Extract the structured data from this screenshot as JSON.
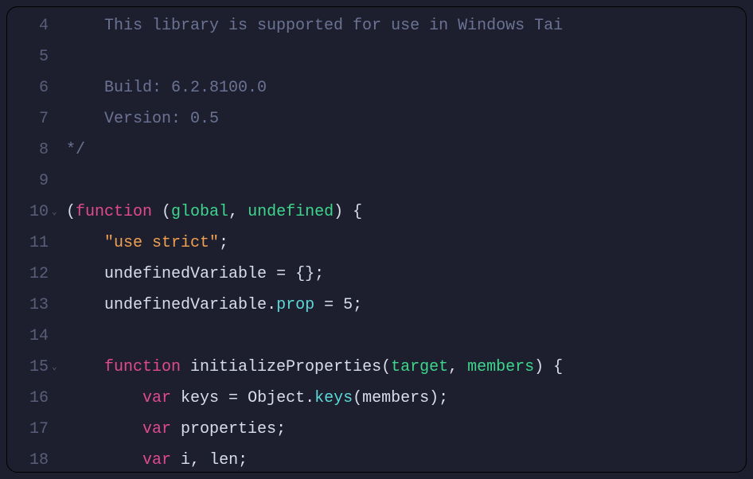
{
  "lines": [
    {
      "num": "4",
      "fold": "",
      "tokens": [
        {
          "cls": "comment",
          "text": "    This library is supported for use in Windows Tai"
        }
      ]
    },
    {
      "num": "5",
      "fold": "",
      "tokens": []
    },
    {
      "num": "6",
      "fold": "",
      "tokens": [
        {
          "cls": "comment",
          "text": "    Build: 6.2.8100.0"
        }
      ]
    },
    {
      "num": "7",
      "fold": "",
      "tokens": [
        {
          "cls": "comment",
          "text": "    Version: 0.5"
        }
      ]
    },
    {
      "num": "8",
      "fold": "",
      "tokens": [
        {
          "cls": "comment",
          "text": "*/"
        }
      ]
    },
    {
      "num": "9",
      "fold": "",
      "tokens": []
    },
    {
      "num": "10",
      "fold": "⌄",
      "tokens": [
        {
          "cls": "paren",
          "text": "("
        },
        {
          "cls": "keyword",
          "text": "function"
        },
        {
          "cls": "paren",
          "text": " ("
        },
        {
          "cls": "param",
          "text": "global"
        },
        {
          "cls": "punct",
          "text": ", "
        },
        {
          "cls": "special",
          "text": "undefined"
        },
        {
          "cls": "paren",
          "text": ")"
        },
        {
          "cls": "punct",
          "text": " {"
        }
      ]
    },
    {
      "num": "11",
      "fold": "",
      "tokens": [
        {
          "cls": "punct",
          "text": "    "
        },
        {
          "cls": "string",
          "text": "\"use strict\""
        },
        {
          "cls": "punct",
          "text": ";"
        }
      ]
    },
    {
      "num": "12",
      "fold": "",
      "tokens": [
        {
          "cls": "punct",
          "text": "    "
        },
        {
          "cls": "ident",
          "text": "undefinedVariable"
        },
        {
          "cls": "op",
          "text": " = "
        },
        {
          "cls": "punct",
          "text": "{};"
        }
      ]
    },
    {
      "num": "13",
      "fold": "",
      "tokens": [
        {
          "cls": "punct",
          "text": "    "
        },
        {
          "cls": "ident",
          "text": "undefinedVariable"
        },
        {
          "cls": "punct",
          "text": "."
        },
        {
          "cls": "prop",
          "text": "prop"
        },
        {
          "cls": "op",
          "text": " = "
        },
        {
          "cls": "number",
          "text": "5"
        },
        {
          "cls": "punct",
          "text": ";"
        }
      ]
    },
    {
      "num": "14",
      "fold": "",
      "tokens": []
    },
    {
      "num": "15",
      "fold": "⌄",
      "tokens": [
        {
          "cls": "punct",
          "text": "    "
        },
        {
          "cls": "keyword",
          "text": "function"
        },
        {
          "cls": "func",
          "text": " initializeProperties"
        },
        {
          "cls": "paren",
          "text": "("
        },
        {
          "cls": "param",
          "text": "target"
        },
        {
          "cls": "punct",
          "text": ", "
        },
        {
          "cls": "param",
          "text": "members"
        },
        {
          "cls": "paren",
          "text": ")"
        },
        {
          "cls": "punct",
          "text": " {"
        }
      ]
    },
    {
      "num": "16",
      "fold": "",
      "tokens": [
        {
          "cls": "punct",
          "text": "        "
        },
        {
          "cls": "keyword",
          "text": "var"
        },
        {
          "cls": "ident",
          "text": " keys"
        },
        {
          "cls": "op",
          "text": " = "
        },
        {
          "cls": "ident",
          "text": "Object"
        },
        {
          "cls": "punct",
          "text": "."
        },
        {
          "cls": "prop",
          "text": "keys"
        },
        {
          "cls": "paren",
          "text": "("
        },
        {
          "cls": "ident",
          "text": "members"
        },
        {
          "cls": "paren",
          "text": ")"
        },
        {
          "cls": "punct",
          "text": ";"
        }
      ]
    },
    {
      "num": "17",
      "fold": "",
      "tokens": [
        {
          "cls": "punct",
          "text": "        "
        },
        {
          "cls": "keyword",
          "text": "var"
        },
        {
          "cls": "ident",
          "text": " properties"
        },
        {
          "cls": "punct",
          "text": ";"
        }
      ]
    },
    {
      "num": "18",
      "fold": "",
      "tokens": [
        {
          "cls": "punct",
          "text": "        "
        },
        {
          "cls": "keyword",
          "text": "var"
        },
        {
          "cls": "ident",
          "text": " i"
        },
        {
          "cls": "punct",
          "text": ", "
        },
        {
          "cls": "ident",
          "text": "len"
        },
        {
          "cls": "punct",
          "text": ";"
        }
      ]
    }
  ]
}
